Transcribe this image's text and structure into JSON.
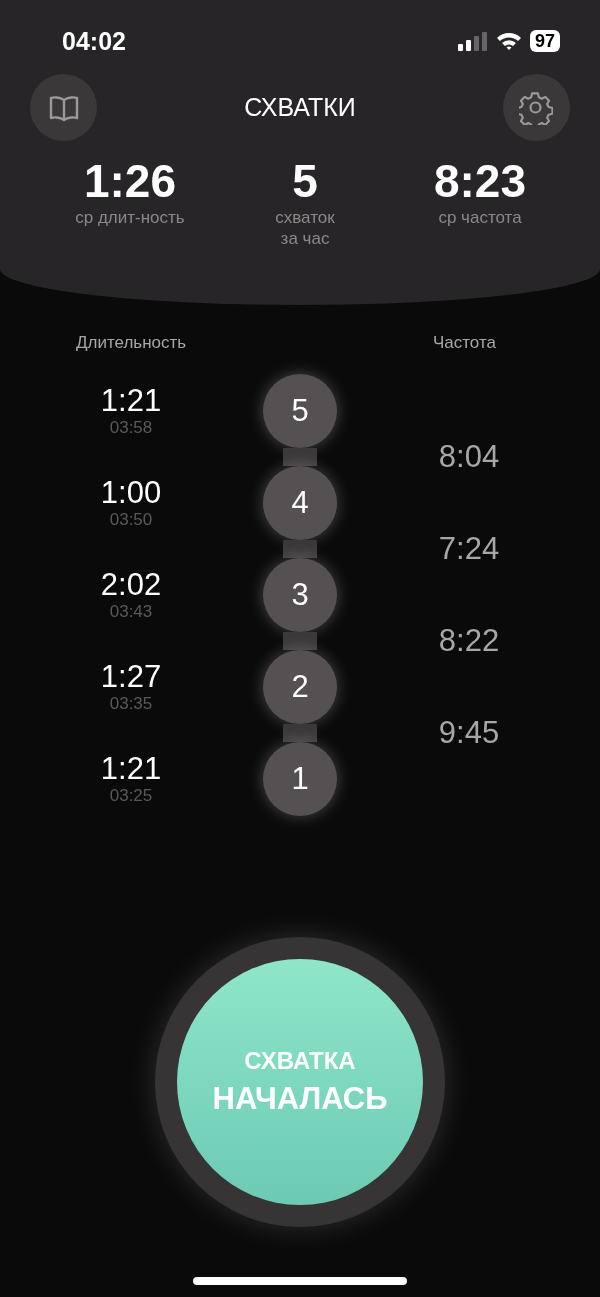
{
  "status_bar": {
    "time": "04:02",
    "battery": "97"
  },
  "header": {
    "title": "СХВАТКИ"
  },
  "stats": [
    {
      "value": "1:26",
      "label": "ср длит-ность"
    },
    {
      "value": "5",
      "label": "схваток за час"
    },
    {
      "value": "8:23",
      "label": "ср частота"
    }
  ],
  "columns": {
    "duration": "Длительность",
    "frequency": "Частота"
  },
  "contractions": [
    {
      "number": "5",
      "duration": "1:21",
      "time": "03:58"
    },
    {
      "number": "4",
      "duration": "1:00",
      "time": "03:50"
    },
    {
      "number": "3",
      "duration": "2:02",
      "time": "03:43"
    },
    {
      "number": "2",
      "duration": "1:27",
      "time": "03:35"
    },
    {
      "number": "1",
      "duration": "1:21",
      "time": "03:25"
    }
  ],
  "frequencies": [
    "8:04",
    "7:24",
    "8:22",
    "9:45"
  ],
  "start_button": {
    "line_1": "СХВАТКА",
    "line_2": "НАЧАЛАСЬ"
  }
}
